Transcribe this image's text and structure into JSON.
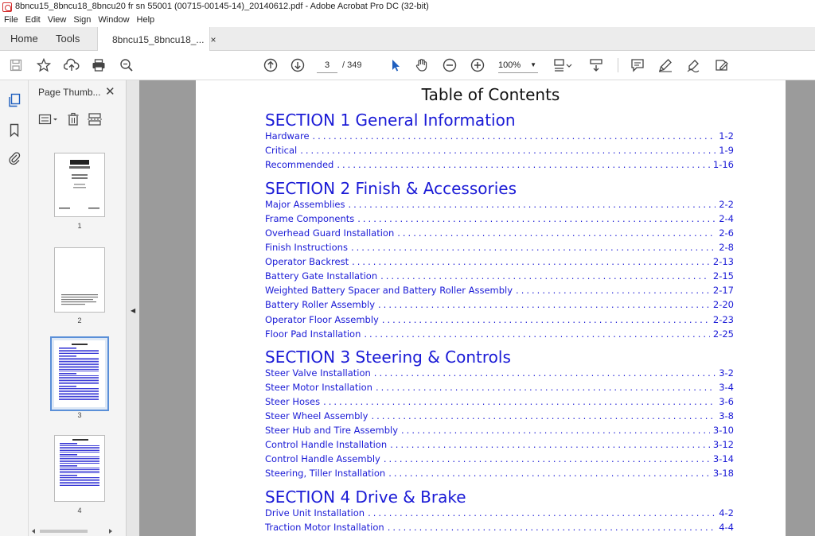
{
  "window": {
    "title": "8bncu15_8bncu18_8bncu20 fr sn 55001 (00715-00145-14)_20140612.pdf - Adobe Acrobat Pro DC (32-bit)"
  },
  "menu": [
    "File",
    "Edit",
    "View",
    "Sign",
    "Window",
    "Help"
  ],
  "tabs": {
    "home": "Home",
    "tools": "Tools",
    "doc": "8bncu15_8bncu18_...",
    "close": "×"
  },
  "nav": {
    "current_page": "3",
    "page_count": "/ 349",
    "zoom": "100%"
  },
  "panel": {
    "title": "Page Thumb...",
    "close": "✕"
  },
  "thumbnails": [
    {
      "label": "1"
    },
    {
      "label": "2"
    },
    {
      "label": "3"
    },
    {
      "label": "4"
    }
  ],
  "toc": {
    "title": "Table of Contents",
    "sections": [
      {
        "heading": "SECTION 1 General Information",
        "entries": [
          {
            "label": "Hardware",
            "page": "1-2"
          },
          {
            "label": "Critical",
            "page": "1-9"
          },
          {
            "label": "Recommended",
            "page": "1-16"
          }
        ]
      },
      {
        "heading": "SECTION 2 Finish & Accessories",
        "entries": [
          {
            "label": "Major Assemblies",
            "page": "2-2"
          },
          {
            "label": "Frame Components",
            "page": "2-4"
          },
          {
            "label": "Overhead Guard Installation",
            "page": "2-6"
          },
          {
            "label": "Finish Instructions",
            "page": "2-8"
          },
          {
            "label": "Operator Backrest",
            "page": "2-13"
          },
          {
            "label": "Battery Gate Installation",
            "page": "2-15"
          },
          {
            "label": "Weighted Battery Spacer and Battery Roller Assembly",
            "page": "2-17"
          },
          {
            "label": "Battery Roller Assembly",
            "page": "2-20"
          },
          {
            "label": "Operator Floor Assembly",
            "page": "2-23"
          },
          {
            "label": "Floor Pad Installation",
            "page": "2-25"
          }
        ]
      },
      {
        "heading": "SECTION 3 Steering & Controls",
        "entries": [
          {
            "label": "Steer Valve Installation",
            "page": "3-2"
          },
          {
            "label": "Steer Motor Installation",
            "page": "3-4"
          },
          {
            "label": "Steer Hoses",
            "page": "3-6"
          },
          {
            "label": "Steer Wheel Assembly",
            "page": "3-8"
          },
          {
            "label": "Steer Hub and Tire Assembly",
            "page": "3-10"
          },
          {
            "label": "Control Handle Installation",
            "page": "3-12"
          },
          {
            "label": "Control Handle Assembly",
            "page": "3-14"
          },
          {
            "label": "Steering, Tiller Installation",
            "page": "3-18"
          }
        ]
      },
      {
        "heading": "SECTION 4 Drive & Brake",
        "entries": [
          {
            "label": "Drive Unit Installation",
            "page": "4-2"
          },
          {
            "label": "Traction Motor Installation",
            "page": "4-4"
          }
        ]
      }
    ]
  }
}
